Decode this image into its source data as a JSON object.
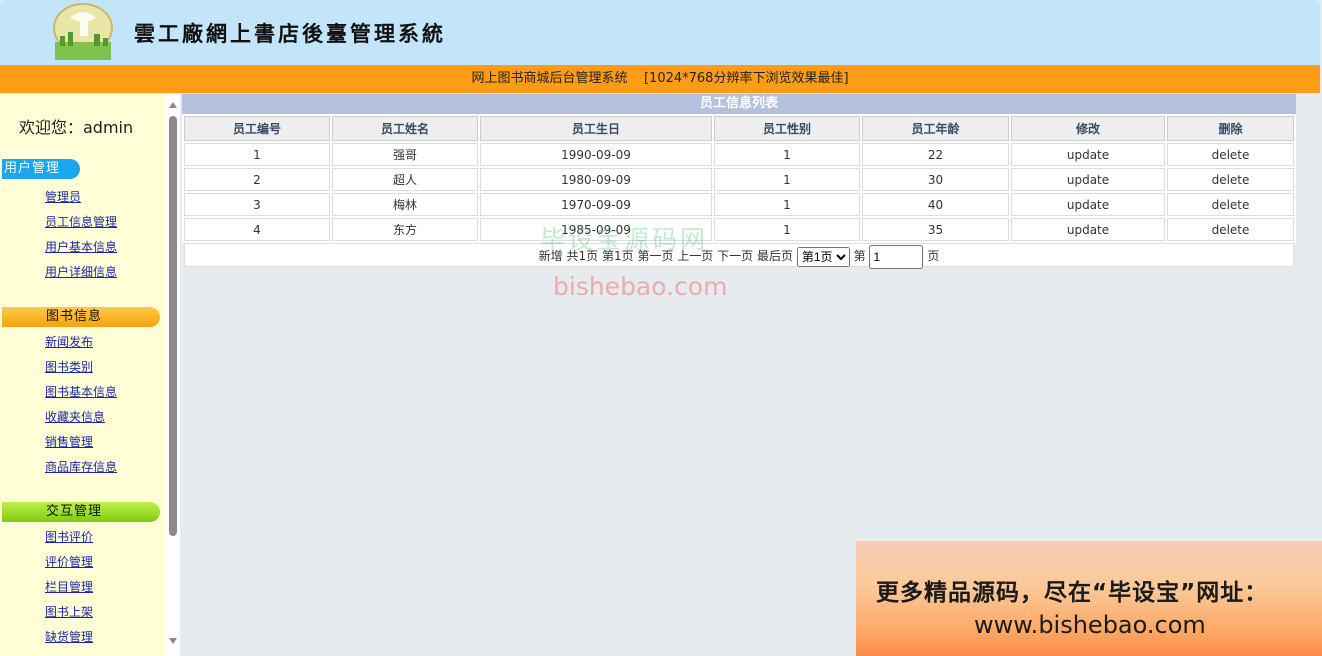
{
  "header": {
    "site_title": "雲工廠網上書店後臺管理系統",
    "notice": "网上图书商城后台管理系统    [1024*768分辨率下浏览效果最佳]"
  },
  "sidebar": {
    "welcome": "欢迎您：admin",
    "sections": [
      {
        "title": "用户管理",
        "color": "#1aa7f0",
        "items": [
          "管理员",
          "员工信息管理",
          "用户基本信息",
          "用户详细信息"
        ]
      },
      {
        "title": "图书信息",
        "color": "#f7a20a",
        "items": [
          "新闻发布",
          "图书类别",
          "图书基本信息",
          "收藏夹信息",
          "销售管理",
          "商品库存信息"
        ]
      },
      {
        "title": "交互管理",
        "color": "#82cb10",
        "items": [
          "图书评价",
          "评价管理",
          "栏目管理",
          "图书上架",
          "缺货管理"
        ]
      }
    ]
  },
  "main": {
    "panel_title": "员工信息列表",
    "columns": [
      "员工编号",
      "员工姓名",
      "员工生日",
      "员工性别",
      "员工年龄",
      "修改",
      "删除"
    ],
    "rows": [
      [
        "1",
        "强哥",
        "1990-09-09",
        "1",
        "22",
        "update",
        "delete"
      ],
      [
        "2",
        "超人",
        "1980-09-09",
        "1",
        "30",
        "update",
        "delete"
      ],
      [
        "3",
        "梅林",
        "1970-09-09",
        "1",
        "40",
        "update",
        "delete"
      ],
      [
        "4",
        "东方",
        "1985-09-09",
        "1",
        "35",
        "update",
        "delete"
      ]
    ],
    "pager": {
      "add": "新增",
      "total": "共1页",
      "current": "第1页",
      "first": "第一页",
      "prev": "上一页",
      "next": "下一页",
      "last": "最后页",
      "select_value": "第1页",
      "goto_prefix": "第",
      "goto_value": "1",
      "goto_suffix": "页"
    }
  },
  "watermark": {
    "cn": "毕设宝源码网",
    "url": "bishebao.com"
  },
  "ad": {
    "line1": "更多精品源码，尽在“毕设宝”网址：",
    "line2": "www.bishebao.com"
  }
}
